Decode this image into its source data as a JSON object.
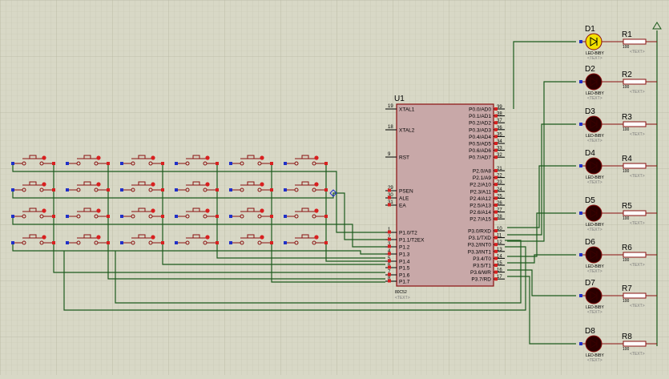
{
  "chip": {
    "ref": "U1",
    "part": "80C52",
    "text_placeholder": "<TEXT>",
    "left_pins": [
      {
        "num": "19",
        "name": "XTAL1"
      },
      {
        "num": "18",
        "name": "XTAL2"
      },
      {
        "num": "9",
        "name": "RST"
      },
      {
        "num": "29",
        "name": "PSEN"
      },
      {
        "num": "30",
        "name": "ALE"
      },
      {
        "num": "31",
        "name": "EA"
      },
      {
        "num": "1",
        "name": "P1.0/T2"
      },
      {
        "num": "2",
        "name": "P1.1/T2EX"
      },
      {
        "num": "3",
        "name": "P1.2"
      },
      {
        "num": "4",
        "name": "P1.3"
      },
      {
        "num": "5",
        "name": "P1.4"
      },
      {
        "num": "6",
        "name": "P1.5"
      },
      {
        "num": "7",
        "name": "P1.6"
      },
      {
        "num": "8",
        "name": "P1.7"
      }
    ],
    "right_pins": [
      {
        "num": "39",
        "name": "P0.0/AD0"
      },
      {
        "num": "38",
        "name": "P0.1/AD1"
      },
      {
        "num": "37",
        "name": "P0.2/AD2"
      },
      {
        "num": "36",
        "name": "P0.3/AD3"
      },
      {
        "num": "35",
        "name": "P0.4/AD4"
      },
      {
        "num": "34",
        "name": "P0.5/AD5"
      },
      {
        "num": "33",
        "name": "P0.6/AD6"
      },
      {
        "num": "32",
        "name": "P0.7/AD7"
      },
      {
        "num": "21",
        "name": "P2.0/A8"
      },
      {
        "num": "22",
        "name": "P2.1/A9"
      },
      {
        "num": "23",
        "name": "P2.2/A10"
      },
      {
        "num": "24",
        "name": "P2.3/A11"
      },
      {
        "num": "25",
        "name": "P2.4/A12"
      },
      {
        "num": "26",
        "name": "P2.5/A13"
      },
      {
        "num": "27",
        "name": "P2.6/A14"
      },
      {
        "num": "28",
        "name": "P2.7/A15"
      },
      {
        "num": "10",
        "name": "P3.0/RXD"
      },
      {
        "num": "11",
        "name": "P3.1/TXD"
      },
      {
        "num": "12",
        "name": "P3.2/INT0"
      },
      {
        "num": "13",
        "name": "P3.3/INT1"
      },
      {
        "num": "14",
        "name": "P3.4/T0"
      },
      {
        "num": "15",
        "name": "P3.5/T1"
      },
      {
        "num": "16",
        "name": "P3.6/WR"
      },
      {
        "num": "17",
        "name": "P3.7/RD"
      }
    ]
  },
  "leds": [
    {
      "ref": "D1",
      "part": "LED-BIBY",
      "text": "<TEXT>",
      "lit": true
    },
    {
      "ref": "D2",
      "part": "LED-BIBY",
      "text": "<TEXT>",
      "lit": false
    },
    {
      "ref": "D3",
      "part": "LED-BIBY",
      "text": "<TEXT>",
      "lit": false
    },
    {
      "ref": "D4",
      "part": "LED-BIBY",
      "text": "<TEXT>",
      "lit": false
    },
    {
      "ref": "D5",
      "part": "LED-BIBY",
      "text": "<TEXT>",
      "lit": false
    },
    {
      "ref": "D6",
      "part": "LED-BIBY",
      "text": "<TEXT>",
      "lit": false
    },
    {
      "ref": "D7",
      "part": "LED-BIBY",
      "text": "<TEXT>",
      "lit": false
    },
    {
      "ref": "D8",
      "part": "LED-BIBY",
      "text": "<TEXT>",
      "lit": false
    }
  ],
  "resistors": [
    {
      "ref": "R1",
      "value": "100",
      "text": "<TEXT>"
    },
    {
      "ref": "R2",
      "value": "100",
      "text": "<TEXT>"
    },
    {
      "ref": "R3",
      "value": "100",
      "text": "<TEXT>"
    },
    {
      "ref": "R4",
      "value": "100",
      "text": "<TEXT>"
    },
    {
      "ref": "R5",
      "value": "100",
      "text": "<TEXT>"
    },
    {
      "ref": "R6",
      "value": "100",
      "text": "<TEXT>"
    },
    {
      "ref": "R7",
      "value": "100",
      "text": "<TEXT>"
    },
    {
      "ref": "R8",
      "value": "100",
      "text": "<TEXT>"
    }
  ],
  "keypad": {
    "rows": 4,
    "cols": 6
  },
  "colors": {
    "background": "#d8d8c6",
    "grid": "#c4c4b0",
    "wire": "#1c5a1c",
    "component": "#8a1010",
    "chip_fill": "#c8a8a8",
    "led_lit": "#f2e000",
    "led_dark": "#2a0000",
    "pin_blue": "#2030c8",
    "pin_red": "#d82020"
  }
}
